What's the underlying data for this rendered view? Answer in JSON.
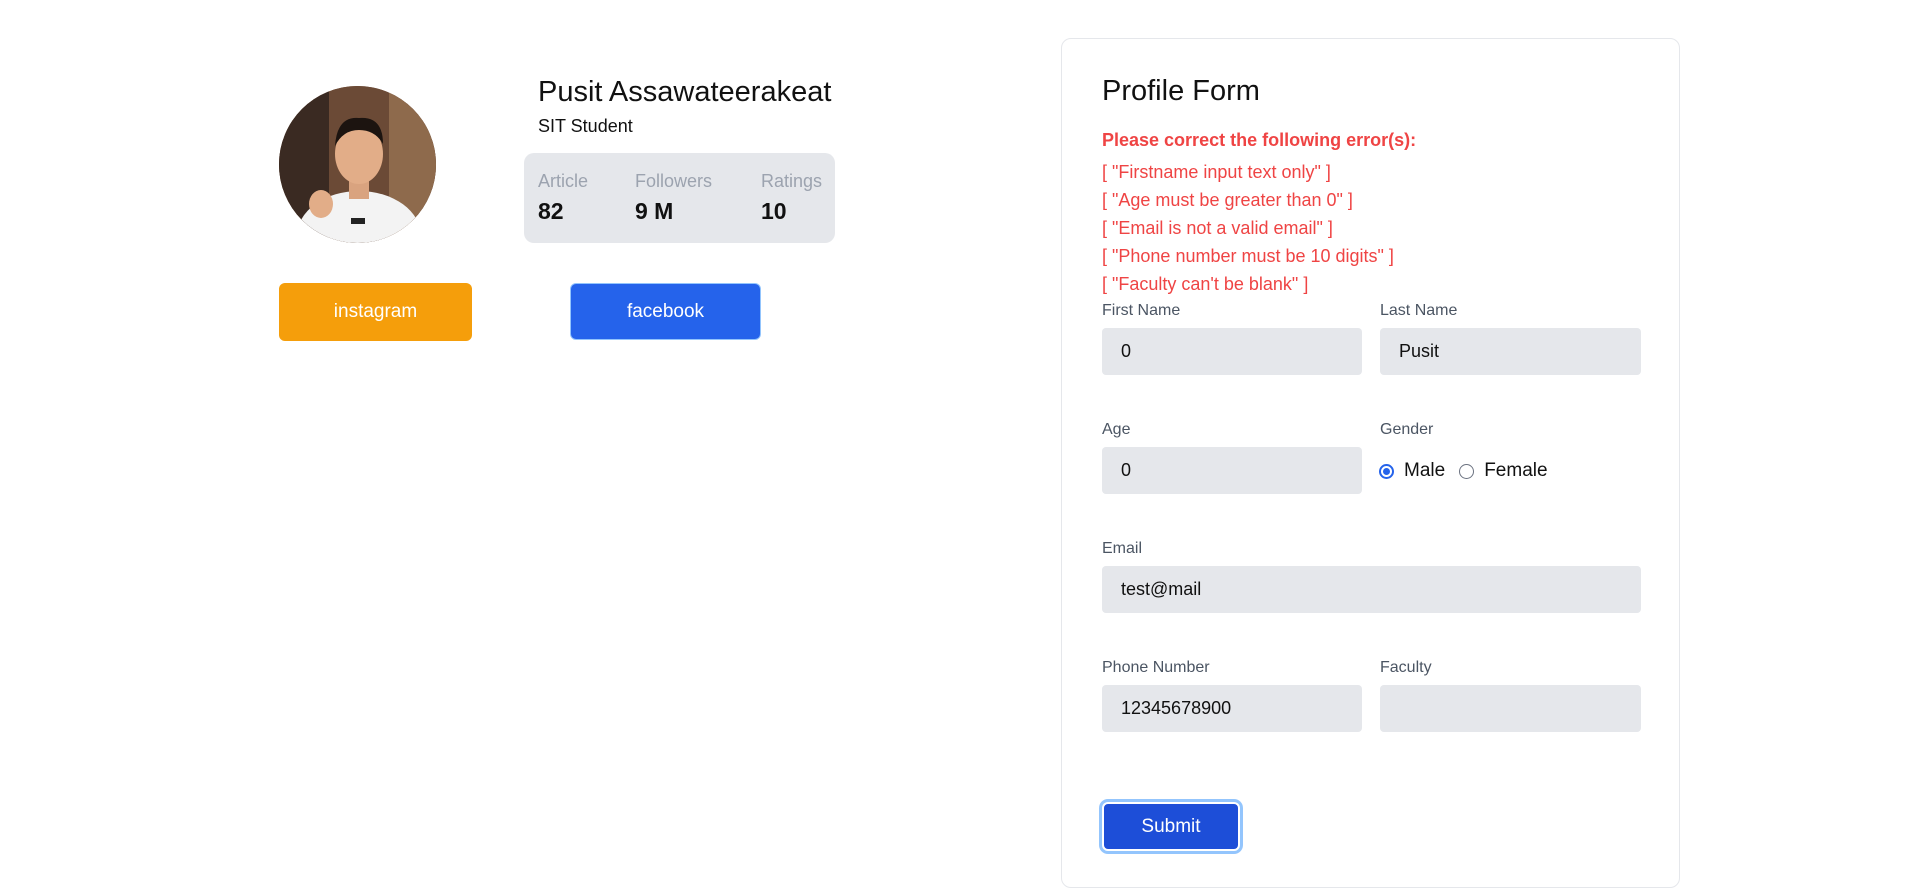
{
  "profile": {
    "name": "Pusit Assawateerakeat",
    "role": "SIT Student",
    "stats": [
      {
        "label": "Article",
        "value": "82"
      },
      {
        "label": "Followers",
        "value": "9 M"
      },
      {
        "label": "Ratings",
        "value": "10"
      }
    ],
    "buttons": {
      "instagram": "instagram",
      "facebook": "facebook"
    }
  },
  "form": {
    "title": "Profile Form",
    "error_heading": "Please correct the following error(s):",
    "errors": [
      "[ \"Firstname input text only\" ]",
      "[ \"Age must be greater than 0\" ]",
      "[ \"Email is not a valid email\" ]",
      "[ \"Phone number must be 10 digits\" ]",
      "[ \"Faculty can't be blank\" ]"
    ],
    "fields": {
      "first_name": {
        "label": "First Name",
        "value": "0"
      },
      "last_name": {
        "label": "Last Name",
        "value": "Pusit"
      },
      "age": {
        "label": "Age",
        "value": "0"
      },
      "gender": {
        "label": "Gender",
        "options": [
          "Male",
          "Female"
        ],
        "selected": "Male"
      },
      "email": {
        "label": "Email",
        "value": "test@mail"
      },
      "phone": {
        "label": "Phone Number",
        "value": "12345678900"
      },
      "faculty": {
        "label": "Faculty",
        "value": ""
      }
    },
    "submit_label": "Submit"
  },
  "colors": {
    "instagram": "#f59e0b",
    "facebook": "#2563eb",
    "submit": "#1d4ed8",
    "error": "#ef4444",
    "input_bg": "#e5e7eb"
  }
}
